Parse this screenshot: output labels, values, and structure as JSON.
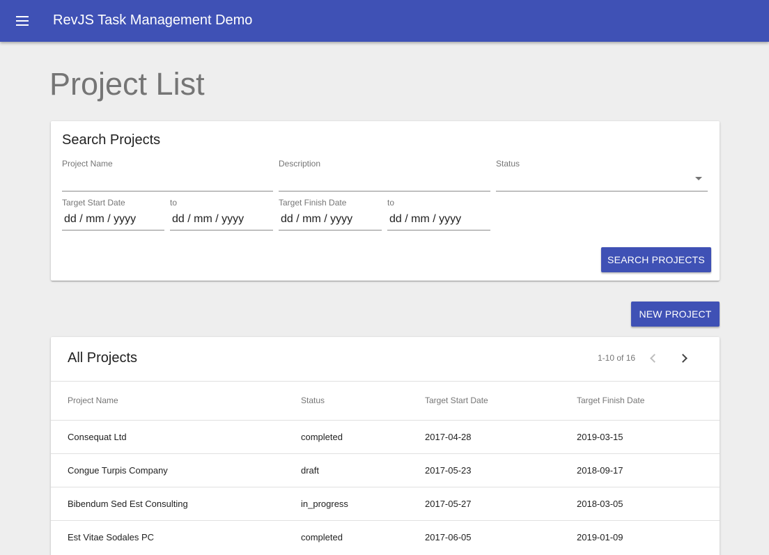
{
  "appbar": {
    "title": "RevJS Task Management Demo"
  },
  "page": {
    "title": "Project List"
  },
  "search": {
    "heading": "Search Projects",
    "project_name_label": "Project Name",
    "description_label": "Description",
    "status_label": "Status",
    "target_start_label": "Target Start Date",
    "to_label": "to",
    "target_finish_label": "Target Finish Date",
    "date_placeholder": "dd / mm / yyyy",
    "button_label": "Search Projects"
  },
  "actions": {
    "new_project_label": "New Project"
  },
  "table": {
    "heading": "All Projects",
    "pagination": "1-10 of 16",
    "columns": [
      "Project Name",
      "Status",
      "Target Start Date",
      "Target Finish Date"
    ],
    "rows": [
      {
        "name": "Consequat Ltd",
        "status": "completed",
        "start": "2017-04-28",
        "finish": "2019-03-15"
      },
      {
        "name": "Congue Turpis Company",
        "status": "draft",
        "start": "2017-05-23",
        "finish": "2018-09-17"
      },
      {
        "name": "Bibendum Sed Est Consulting",
        "status": "in_progress",
        "start": "2017-05-27",
        "finish": "2018-03-05"
      },
      {
        "name": "Est Vitae Sodales PC",
        "status": "completed",
        "start": "2017-06-05",
        "finish": "2019-01-09"
      }
    ]
  },
  "icons": {
    "menu": "menu-icon",
    "prev": "chevron-left-icon",
    "next": "chevron-right-icon",
    "dropdown": "arrow-drop-down-icon"
  },
  "colors": {
    "primary": "#3f51b5",
    "background": "#eeeeee"
  }
}
